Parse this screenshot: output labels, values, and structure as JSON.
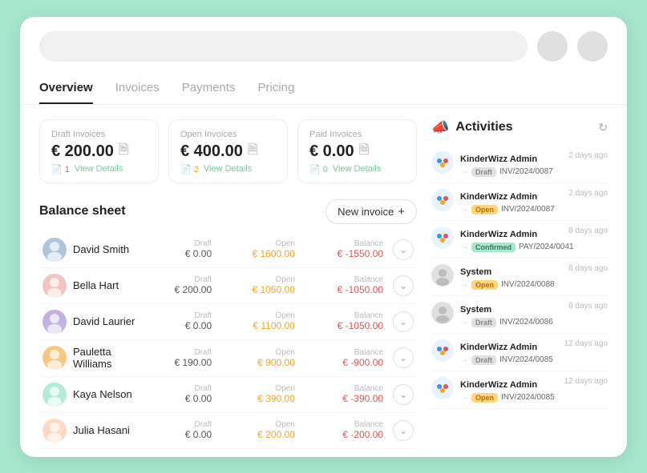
{
  "window": {
    "background": "#a8e6cf"
  },
  "topbar": {
    "icon1": "user-icon",
    "icon2": "notification-icon"
  },
  "nav": {
    "tabs": [
      {
        "label": "Overview",
        "active": true
      },
      {
        "label": "Invoices",
        "active": false
      },
      {
        "label": "Payments",
        "active": false
      },
      {
        "label": "Pricing",
        "active": false
      }
    ]
  },
  "summary": {
    "draft": {
      "label": "Draft Invoices",
      "amount": "€ 200.00",
      "count": "1",
      "link": "View Details"
    },
    "open": {
      "label": "Open Invoices",
      "amount": "€ 400.00",
      "count": "2",
      "link": "View Details"
    },
    "paid": {
      "label": "Paid Invoices",
      "amount": "€ 0.00",
      "count": "0",
      "link": "View Details"
    }
  },
  "balance_sheet": {
    "title": "Balance sheet",
    "new_invoice_label": "New invoice",
    "columns": {
      "draft": "Draft",
      "open": "Open",
      "balance": "Balance"
    },
    "rows": [
      {
        "name": "David Smith",
        "draft": "€ 0.00",
        "open": "€ 1600.00",
        "balance": "€ -1550.00"
      },
      {
        "name": "Bella Hart",
        "draft": "€ 200.00",
        "open": "€ 1050.00",
        "balance": "€ -1050.00"
      },
      {
        "name": "David Laurier",
        "draft": "€ 0.00",
        "open": "€ 1100.00",
        "balance": "€ -1050.00"
      },
      {
        "name": "Pauletta Williams",
        "draft": "€ 190.00",
        "open": "€ 900.00",
        "balance": "€ -900.00"
      },
      {
        "name": "Kaya Nelson",
        "draft": "€ 0.00",
        "open": "€ 390.00",
        "balance": "€ -390.00"
      },
      {
        "name": "Julia Hasani",
        "draft": "€ 0.00",
        "open": "€ 200.00",
        "balance": "€ -200.00"
      }
    ]
  },
  "activities": {
    "title": "Activities",
    "items": [
      {
        "user": "KinderWizz Admin",
        "time": "2 days ago",
        "badge": "Draft",
        "badge_type": "draft",
        "invoice": "INV/2024/0087"
      },
      {
        "user": "KinderWizz Admin",
        "time": "2 days ago",
        "badge": "Open",
        "badge_type": "open",
        "invoice": "INV/2024/0087"
      },
      {
        "user": "KinderWizz Admin",
        "time": "8 days ago",
        "badge": "Confirmed",
        "badge_type": "confirmed",
        "invoice": "PAY/2024/0041"
      },
      {
        "user": "System",
        "time": "8 days ago",
        "badge": "Open",
        "badge_type": "open",
        "invoice": "INV/2024/0088"
      },
      {
        "user": "System",
        "time": "8 days ago",
        "badge": "Draft",
        "badge_type": "draft",
        "invoice": "INV/2024/0086"
      },
      {
        "user": "KinderWizz Admin",
        "time": "12 days ago",
        "badge": "Draft",
        "badge_type": "draft",
        "invoice": "INV/2024/0085"
      },
      {
        "user": "KinderWizz Admin",
        "time": "12 days ago",
        "badge": "Open",
        "badge_type": "open",
        "invoice": "INV/2024/0085"
      }
    ]
  }
}
